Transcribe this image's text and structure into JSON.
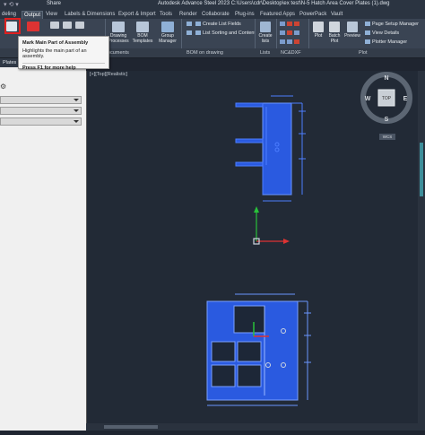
{
  "title_bar": {
    "share_label": "Share",
    "app_title": "Autodesk Advance Steel 2023    C:\\Users\\cdr\\Desktop\\ex test\\N-5 Hatch Area Cover Plates (1).dwg"
  },
  "tabs": [
    {
      "label": "deling"
    },
    {
      "label": "Output"
    },
    {
      "label": "View"
    },
    {
      "label": "Labels & Dimensions"
    },
    {
      "label": "Export & Import"
    },
    {
      "label": "Tools"
    },
    {
      "label": "Render"
    },
    {
      "label": "Collaborate"
    },
    {
      "label": "Plug-ins"
    },
    {
      "label": "Featured Apps"
    },
    {
      "label": "PowerPack"
    },
    {
      "label": "Vault"
    }
  ],
  "ribbon": {
    "drawing_processes": "Drawing\nProcesses",
    "bom_templates": "BOM\nTemplates",
    "group_manager": "Group\nManager",
    "create_list_fields": "Create List Fields",
    "list_sorting": "List Sorting and Content",
    "create_lists": "Create\nlists",
    "plot": "Plot",
    "batch_plot": "Batch\nPlot",
    "preview": "Preview",
    "page_setup": "Page Setup Manager",
    "view_details": "View Details",
    "plotter_manager": "Plotter Manager"
  },
  "panel_labels": {
    "documents": "ocuments",
    "bom_on_drawing": "BOM on drawing",
    "lists": "Lists",
    "nc_dxf": "NC&DXF",
    "plot": "Plot"
  },
  "tooltip": {
    "title": "Mark Main Part of Assembly",
    "description": "Highlights the main part of an assembly.",
    "help": "Press F1 for more help"
  },
  "left_panel": {
    "header": "Plates"
  },
  "viewport": {
    "label": "[+][Top][Realistic]",
    "viewcube_face": "TOP",
    "compass_n": "N",
    "compass_s": "S",
    "compass_e": "E",
    "compass_w": "W",
    "wcs": "WCS"
  },
  "colors": {
    "ribbon_bg": "#3a4453",
    "viewport_bg": "#222a36",
    "plate_blue": "#2a5ae0",
    "tooltip_bg": "#f5f5f5",
    "highlight_red": "#e02020"
  }
}
